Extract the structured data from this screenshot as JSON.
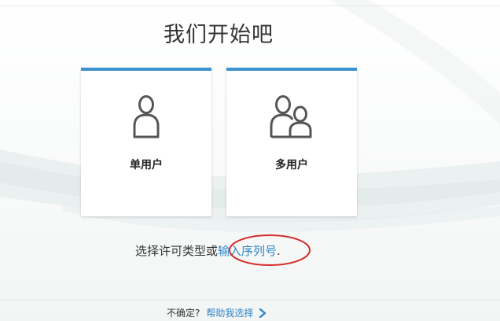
{
  "page": {
    "title": "我们开始吧"
  },
  "cards": [
    {
      "label": "单用户",
      "icon": "single-user-icon"
    },
    {
      "label": "多用户",
      "icon": "multi-user-icon"
    }
  ],
  "license": {
    "prompt_text": "选择许可类型或",
    "serial_link": "输入序列号",
    "trailing": "."
  },
  "footer": {
    "question": "不确定?",
    "help_link": "帮助我选择",
    "chevron_icon": "chevron-right-icon"
  },
  "colors": {
    "accent": "#3d92d0",
    "link": "#2f86c8",
    "annotation": "#d62d2d"
  }
}
